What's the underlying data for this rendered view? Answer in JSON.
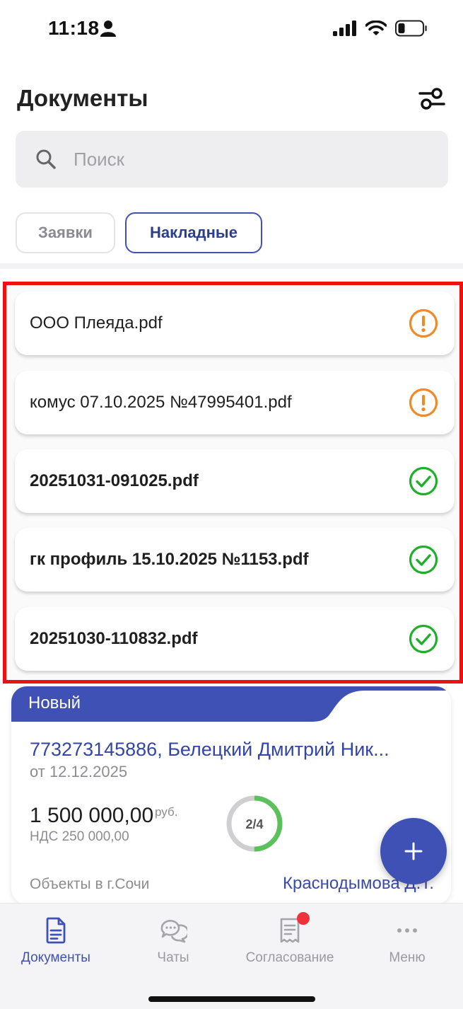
{
  "status_bar": {
    "time": "11:18"
  },
  "header": {
    "title": "Документы"
  },
  "search": {
    "placeholder": "Поиск"
  },
  "tabs": [
    {
      "label": "Заявки",
      "active": false
    },
    {
      "label": "Накладные",
      "active": true
    }
  ],
  "documents": [
    {
      "name": "ООО Плеяда.pdf",
      "status": "warning",
      "status_icon": "warning-circle-icon",
      "bold": false
    },
    {
      "name": "комус 07.10.2025 №47995401.pdf",
      "status": "warning",
      "status_icon": "warning-circle-icon",
      "bold": false
    },
    {
      "name": "20251031-091025.pdf",
      "status": "ok",
      "status_icon": "check-circle-icon",
      "bold": true
    },
    {
      "name": "гк профиль 15.10.2025 №1153.pdf",
      "status": "ok",
      "status_icon": "check-circle-icon",
      "bold": true
    },
    {
      "name": "20251030-110832.pdf",
      "status": "ok",
      "status_icon": "check-circle-icon",
      "bold": true
    }
  ],
  "order_card": {
    "badge": "Новый",
    "title": "773273145886, Белецкий Дмитрий Ник...",
    "date": "от 12.12.2025",
    "amount": "1 500 000,00",
    "currency": "руб.",
    "vat": "НДС 250 000,00",
    "progress_text": "2/4",
    "progress_fraction": 0.5,
    "object": "Объекты в г.Сочи",
    "assignee": "Краснодымова Д.Т."
  },
  "bottom_nav": [
    {
      "label": "Документы",
      "icon": "document-icon",
      "active": true
    },
    {
      "label": "Чаты",
      "icon": "chat-icon",
      "active": false
    },
    {
      "label": "Согласование",
      "icon": "receipt-icon",
      "active": false,
      "badge": true
    },
    {
      "label": "Меню",
      "icon": "more-dots-icon",
      "active": false
    }
  ],
  "colors": {
    "accent": "#3f51b5",
    "warning": "#f08a24",
    "success": "#1fb02a",
    "highlight_border": "#ee1111"
  }
}
